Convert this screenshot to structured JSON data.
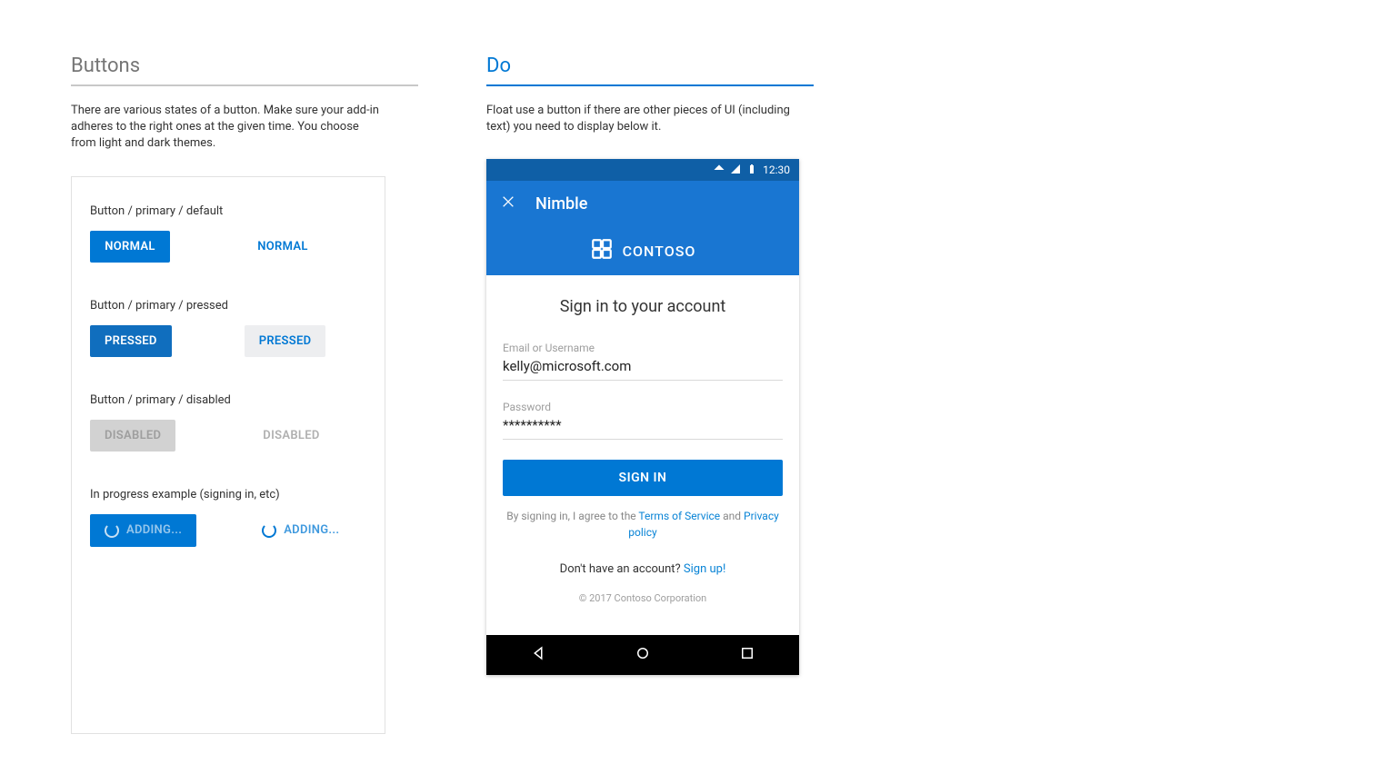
{
  "left": {
    "title": "Buttons",
    "desc": "There are various states of a button. Make sure your add-in adheres to the right ones at the given time. You choose from light and dark themes.",
    "states": [
      {
        "label": "Button / primary / default",
        "filled": "NORMAL",
        "text": "NORMAL",
        "variant": "default"
      },
      {
        "label": "Button / primary / pressed",
        "filled": "PRESSED",
        "text": "PRESSED",
        "variant": "pressed"
      },
      {
        "label": "Button / primary / disabled",
        "filled": "DISABLED",
        "text": "DISABLED",
        "variant": "disabled"
      },
      {
        "label": "In progress example (signing in, etc)",
        "filled": "ADDING...",
        "text": "ADDING...",
        "variant": "loading"
      }
    ]
  },
  "right": {
    "title": "Do",
    "desc": "Float use a button if there are other pieces of UI (including text) you need to display below it."
  },
  "phone": {
    "status_time": "12:30",
    "app_title": "Nimble",
    "brand": "CONTOSO",
    "form_title": "Sign in to your account",
    "email_label": "Email or Username",
    "email_value": "kelly@microsoft.com",
    "password_label": "Password",
    "password_value": "**********",
    "signin": "SIGN IN",
    "agree_prefix": "By signing in, I agree to the ",
    "tos": "Terms of Service",
    "agree_mid": " and ",
    "privacy": "Privacy policy",
    "noacct_prefix": "Don't have an account? ",
    "signup": "Sign up!",
    "copyright": "© 2017 Contoso Corporation"
  }
}
